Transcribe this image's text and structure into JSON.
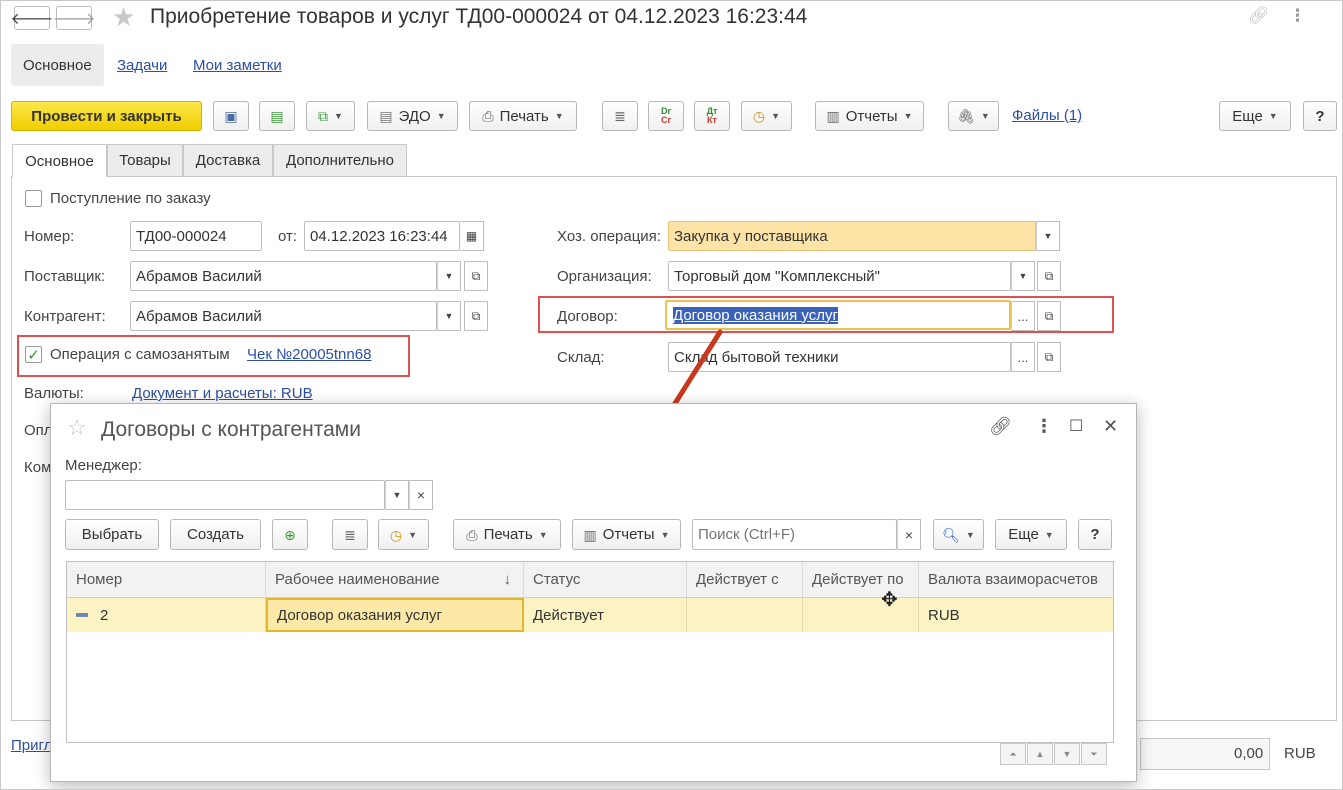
{
  "window": {
    "title": "Приобретение товаров и услуг ТД00-000024 от 04.12.2023 16:23:44",
    "back_icon": "arrow-left-icon",
    "forward_icon": "arrow-right-icon"
  },
  "top_tabs": [
    {
      "label": "Основное"
    },
    {
      "label": "Задачи"
    },
    {
      "label": "Мои заметки"
    }
  ],
  "toolbar": {
    "post_close": "Провести и закрыть",
    "edo": "ЭДО",
    "print": "Печать",
    "dr_cr": {
      "top": "Dr",
      "bottom": "Cr"
    },
    "dt_kt": {
      "top": "Дт",
      "bottom": "Кт"
    },
    "reports": "Отчеты",
    "files": "Файлы (1)",
    "more": "Еще",
    "help": "?"
  },
  "section_tabs": [
    "Основное",
    "Товары",
    "Доставка",
    "Дополнительно"
  ],
  "form": {
    "by_order_label": "Поступление по заказу",
    "number_label": "Номер:",
    "number_value": "ТД00-000024",
    "date_label": "от:",
    "date_value": "04.12.2023 16:23:44",
    "supplier_label": "Поставщик:",
    "supplier_value": "Абрамов Василий",
    "counterparty_label": "Контрагент:",
    "counterparty_value": "Абрамов Василий",
    "self_employed_label": "Операция с самозанятым",
    "self_employed_checked": true,
    "receipt_link": "Чек №20005tnn68",
    "currencies_label": "Валюты:",
    "currencies_link": "Документ и расчеты: RUB",
    "payment_label_partial": "Опл",
    "comment_label_partial": "Ком",
    "operation_label": "Хоз. операция:",
    "operation_value": "Закупка у поставщика",
    "organization_label": "Организация:",
    "organization_value": "Торговый дом \"Комплексный\"",
    "contract_label": "Договор:",
    "contract_value": "Договор оказания услуг",
    "warehouse_label": "Склад:",
    "warehouse_value": "Склад бытовой техники",
    "ellipsis": "...",
    "bottom_link_partial": "Пригл",
    "total_value": "0,00",
    "total_currency": "RUB"
  },
  "dialog": {
    "title": "Договоры с контрагентами",
    "manager_label": "Менеджер:",
    "manager_value": "",
    "clear": "×",
    "buttons": {
      "select": "Выбрать",
      "create": "Создать",
      "print": "Печать",
      "reports": "Отчеты",
      "more": "Еще",
      "help": "?"
    },
    "search_placeholder": "Поиск (Ctrl+F)",
    "columns": [
      "Номер",
      "Рабочее наименование",
      "Статус",
      "Действует с",
      "Действует по",
      "Валюта взаиморасчетов"
    ],
    "sort_indicator": "↓",
    "rows": [
      {
        "number": "2",
        "name": "Договор оказания услуг",
        "status": "Действует",
        "from": "",
        "to": "",
        "currency": "RUB"
      }
    ]
  },
  "colors": {
    "accent_yellow": "#f1ce00",
    "link_blue": "#2c4fa3",
    "highlight_red": "#e05050",
    "arrow_red": "#c8381e",
    "row_yellow": "#fbf3c4"
  }
}
